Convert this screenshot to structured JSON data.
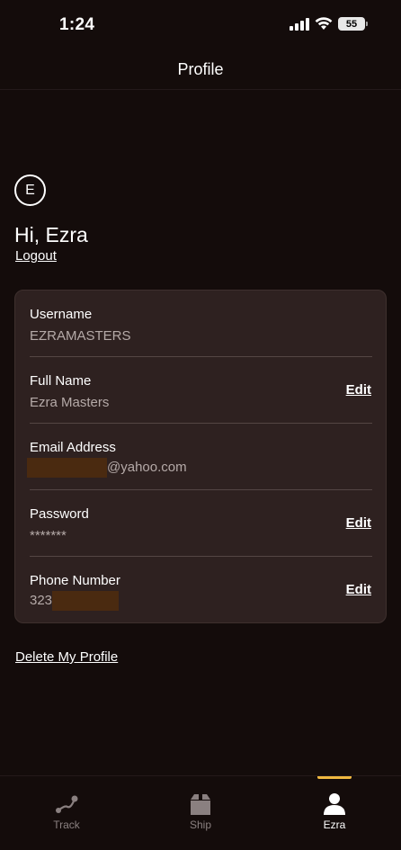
{
  "status_bar": {
    "time": "1:24",
    "battery": "55"
  },
  "header": {
    "title": "Profile"
  },
  "profile": {
    "avatar_initial": "E",
    "greeting": "Hi, Ezra",
    "logout_label": "Logout"
  },
  "fields": {
    "username": {
      "label": "Username",
      "value": "EZRAMASTERS"
    },
    "full_name": {
      "label": "Full Name",
      "value": "Ezra Masters",
      "edit_label": "Edit"
    },
    "email": {
      "label": "Email Address",
      "value_suffix": "@yahoo.com"
    },
    "password": {
      "label": "Password",
      "value": "*******",
      "edit_label": "Edit"
    },
    "phone": {
      "label": "Phone Number",
      "value_prefix": "323",
      "edit_label": "Edit"
    }
  },
  "delete_profile_label": "Delete My Profile",
  "tabs": [
    {
      "label": "Track",
      "icon": "route-icon",
      "active": false
    },
    {
      "label": "Ship",
      "icon": "package-icon",
      "active": false
    },
    {
      "label": "Ezra",
      "icon": "person-icon",
      "active": true
    }
  ],
  "colors": {
    "background": "#140c0b",
    "card": "#2e2120",
    "accent": "#f0b840",
    "muted_text": "#b5aaa8"
  }
}
